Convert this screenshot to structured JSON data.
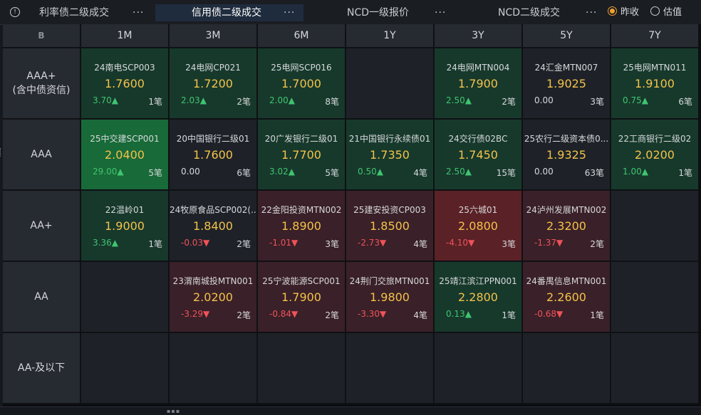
{
  "tabs": [
    {
      "label": "利率债二级成交",
      "more": "···",
      "active": false
    },
    {
      "label": "信用债二级成交",
      "more": "···",
      "active": true
    },
    {
      "label": "NCD一级报价",
      "more": "···",
      "active": false
    },
    {
      "label": "NCD二级成交",
      "more": "···",
      "active": false
    }
  ],
  "radios": [
    {
      "label": "昨收",
      "checked": true
    },
    {
      "label": "估值",
      "checked": false
    }
  ],
  "corner_icon": "B",
  "columns": [
    "1M",
    "3M",
    "6M",
    "1Y",
    "3Y",
    "5Y",
    "7Y"
  ],
  "rows": [
    {
      "label": "AAA+\n(含中债资信)",
      "cells": [
        {
          "name": "24南电SCP003",
          "rate": "1.7600",
          "chg": "3.70▲",
          "dir": "up",
          "cnt": "1笔",
          "tone": "green1"
        },
        {
          "name": "24电网CP021",
          "rate": "1.7200",
          "chg": "2.03▲",
          "dir": "up",
          "cnt": "2笔",
          "tone": "green1"
        },
        {
          "name": "25电网SCP016",
          "rate": "1.7000",
          "chg": "2.00▲",
          "dir": "up",
          "cnt": "8笔",
          "tone": "green1"
        },
        null,
        {
          "name": "24电网MTN004",
          "rate": "1.7900",
          "chg": "2.50▲",
          "dir": "up",
          "cnt": "2笔",
          "tone": "green1"
        },
        {
          "name": "24汇金MTN007",
          "rate": "1.9025",
          "chg": "0.00",
          "dir": "flat",
          "cnt": "3笔",
          "tone": "dark"
        },
        {
          "name": "25电网MTN011",
          "rate": "1.9100",
          "chg": "0.75▲",
          "dir": "up",
          "cnt": "6笔",
          "tone": "green1"
        }
      ]
    },
    {
      "label": "AAA",
      "cells": [
        {
          "name": "25中交建SCP001",
          "rate": "2.0400",
          "chg": "29.00▲",
          "dir": "up",
          "cnt": "5笔",
          "tone": "green2"
        },
        {
          "name": "20中国银行二级01",
          "rate": "1.7600",
          "chg": "0.00",
          "dir": "flat",
          "cnt": "6笔",
          "tone": "dark"
        },
        {
          "name": "20广发银行二级01",
          "rate": "1.7700",
          "chg": "3.02▲",
          "dir": "up",
          "cnt": "5笔",
          "tone": "green1"
        },
        {
          "name": "21中国银行永续债01",
          "rate": "1.7350",
          "chg": "0.50▲",
          "dir": "up",
          "cnt": "4笔",
          "tone": "green1"
        },
        {
          "name": "24交行债02BC",
          "rate": "1.7450",
          "chg": "2.50▲",
          "dir": "up",
          "cnt": "15笔",
          "tone": "green1"
        },
        {
          "name": "25农行二级资本债0...",
          "rate": "1.9325",
          "chg": "0.00",
          "dir": "flat",
          "cnt": "63笔",
          "tone": "dark"
        },
        {
          "name": "22工商银行二级02",
          "rate": "2.0200",
          "chg": "1.00▲",
          "dir": "up",
          "cnt": "1笔",
          "tone": "green1"
        }
      ]
    },
    {
      "label": "AA+",
      "cells": [
        {
          "name": "22温岭01",
          "rate": "1.9000",
          "chg": "3.36▲",
          "dir": "up",
          "cnt": "1笔",
          "tone": "green1"
        },
        {
          "name": "24牧原食品SCP002(...",
          "rate": "1.8400",
          "chg": "-0.03▼",
          "dir": "down",
          "cnt": "2笔",
          "tone": "dark"
        },
        {
          "name": "22金阳投资MTN002",
          "rate": "1.8900",
          "chg": "-1.01▼",
          "dir": "down",
          "cnt": "3笔",
          "tone": "red1"
        },
        {
          "name": "25建安投资CP003",
          "rate": "1.8500",
          "chg": "-2.73▼",
          "dir": "down",
          "cnt": "4笔",
          "tone": "red1"
        },
        {
          "name": "25六城01",
          "rate": "2.0800",
          "chg": "-4.10▼",
          "dir": "down",
          "cnt": "3笔",
          "tone": "red2"
        },
        {
          "name": "24泸州发展MTN002",
          "rate": "2.3200",
          "chg": "-1.37▼",
          "dir": "down",
          "cnt": "2笔",
          "tone": "red1"
        },
        null
      ]
    },
    {
      "label": "AA",
      "cells": [
        null,
        {
          "name": "23渭南城投MTN001",
          "rate": "2.0200",
          "chg": "-3.29▼",
          "dir": "down",
          "cnt": "2笔",
          "tone": "red1"
        },
        {
          "name": "25宁波能源SCP001",
          "rate": "1.7900",
          "chg": "-0.84▼",
          "dir": "down",
          "cnt": "2笔",
          "tone": "red1"
        },
        {
          "name": "24荆门交旅MTN001",
          "rate": "1.9800",
          "chg": "-3.30▼",
          "dir": "down",
          "cnt": "4笔",
          "tone": "red1"
        },
        {
          "name": "25靖江滨江PPN001",
          "rate": "2.2800",
          "chg": "0.13▲",
          "dir": "up",
          "cnt": "1笔",
          "tone": "green1"
        },
        {
          "name": "24番禺信息MTN001",
          "rate": "2.2600",
          "chg": "-0.68▼",
          "dir": "down",
          "cnt": "1笔",
          "tone": "red1"
        },
        null
      ]
    },
    {
      "label": "AA-及以下",
      "cells": [
        null,
        null,
        null,
        null,
        null,
        null,
        null
      ]
    }
  ],
  "colors": {
    "up": "#3fc56f",
    "down": "#f0525a",
    "rate": "#f3c24a",
    "accent": "#f0a030"
  }
}
